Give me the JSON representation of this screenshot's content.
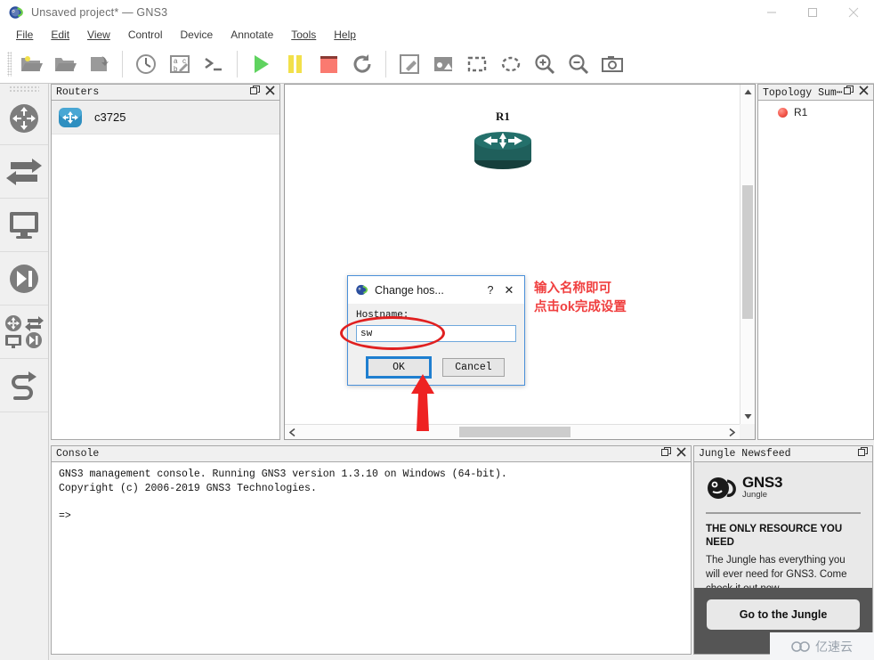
{
  "window": {
    "title": "Unsaved project* — GNS3",
    "logo_icon": "gns3-chameleon-icon",
    "controls": [
      {
        "name": "minimize",
        "glyph": "—"
      },
      {
        "name": "maximize",
        "glyph": "▢"
      },
      {
        "name": "close",
        "glyph": "✕"
      }
    ]
  },
  "menubar": {
    "items": [
      {
        "label": "File",
        "accel": "F"
      },
      {
        "label": "Edit",
        "accel": "E"
      },
      {
        "label": "View",
        "accel": "V"
      },
      {
        "label": "Control",
        "accel": "C"
      },
      {
        "label": "Device",
        "accel": "D"
      },
      {
        "label": "Annotate",
        "accel": "A"
      },
      {
        "label": "Tools",
        "accel": "T"
      },
      {
        "label": "Help",
        "accel": "H"
      }
    ]
  },
  "toolbar": {
    "groups": [
      [
        "new-project-icon",
        "open-project-icon",
        "save-project-icon"
      ],
      [
        "snapshot-clock-icon",
        "screenshot-abc-icon",
        "console-prompt-icon"
      ],
      [
        "start-all-icon",
        "pause-all-icon",
        "stop-all-icon",
        "reload-all-icon"
      ],
      [
        "add-note-icon",
        "insert-image-icon",
        "draw-rectangle-icon",
        "draw-ellipse-icon",
        "zoom-in-icon",
        "zoom-out-icon",
        "screen-capture-icon"
      ]
    ]
  },
  "rail": {
    "items": [
      {
        "name": "routers-category",
        "icon": "router-icon"
      },
      {
        "name": "switches-category",
        "icon": "switch-icon"
      },
      {
        "name": "end-devices-category",
        "icon": "monitor-icon"
      },
      {
        "name": "security-devices-category",
        "icon": "firewall-icon"
      },
      {
        "name": "all-devices-category",
        "icon": "all-devices-icon"
      },
      {
        "name": "add-link",
        "icon": "link-cable-icon"
      }
    ]
  },
  "routers_panel": {
    "title": "Routers",
    "float_icon": "undock-icon",
    "close_icon": "close-icon",
    "devices": [
      {
        "label": "c3725",
        "icon": "router-device-icon"
      }
    ]
  },
  "canvas": {
    "nodes": [
      {
        "label": "R1",
        "icon": "router-3d-icon"
      }
    ],
    "vscroll": {
      "up": "▲",
      "down": "▼"
    },
    "hscroll": {
      "left": "‹",
      "right": "›"
    }
  },
  "topology_panel": {
    "title": "Topology Sum⋯",
    "float_icon": "undock-icon",
    "close_icon": "close-icon",
    "nodes": [
      {
        "label": "R1",
        "status": "stopped",
        "status_color": "#f4564a"
      }
    ]
  },
  "console_panel": {
    "title": "Console",
    "float_icon": "undock-icon",
    "close_icon": "close-icon",
    "text": "GNS3 management console. Running GNS3 version 1.3.10 on Windows (64-bit).\nCopyright (c) 2006-2019 GNS3 Technologies.\n\n=>"
  },
  "newsfeed_panel": {
    "title": "Jungle Newsfeed",
    "float_icon": "undock-icon",
    "logo_icon": "gns3-jungle-logo-icon",
    "logo_title": "GNS3",
    "logo_subtitle": "Jungle",
    "headline": "THE ONLY RESOURCE YOU NEED",
    "description": "The Jungle has everything you will ever need for GNS3. Come check it out now.",
    "cta_label": "Go to the Jungle"
  },
  "dialog": {
    "icon": "gns3-chameleon-icon",
    "title": "Change hos...",
    "help_glyph": "?",
    "close_glyph": "✕",
    "field_label": "Hostname:",
    "field_value": "sw",
    "field_placeholder": "",
    "ok_label": "OK",
    "cancel_label": "Cancel",
    "focused_button": "OK"
  },
  "annotations": {
    "text_line1": "输入名称即可",
    "text_line2": "点击ok完成设置",
    "color": "#f04040",
    "ellipse_target": "hostname-input",
    "arrow_target": "ok-button"
  },
  "watermark": {
    "label": "亿速云",
    "icon": "cloud-icon"
  }
}
